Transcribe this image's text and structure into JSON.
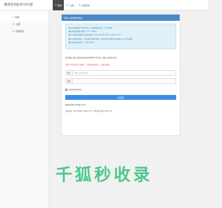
{
  "app": {
    "brand": "聚网签到助手VIP2版"
  },
  "topnav": [
    {
      "icon": "home-icon",
      "label": "登录",
      "active": true
    },
    {
      "icon": "user-icon",
      "label": "注册",
      "active": false
    },
    {
      "icon": "search-icon",
      "label": "找回密码",
      "active": false
    }
  ],
  "sidebar": [
    {
      "icon": "home-icon",
      "label": "登录",
      "active": true
    },
    {
      "icon": "user-icon",
      "label": "注册",
      "active": false
    },
    {
      "icon": "search-icon",
      "label": "找回密码",
      "active": false
    }
  ],
  "panel": {
    "title": "请输入您的账号信息",
    "alert_lines": [
      "●vip功能请购买VIP后使用，可开通/续费年度一个月使用权",
      "●如需帮助请联系客服，QQ：10000",
      "●vip到期后可重新购买继续使用：https://sqbot.10077.qqbao.com/",
      "●vip功能暂停购买，如有疑问请联系客服，联系前请先查看常见问题和公告，联系客服",
      "●如有疑问请加QQ：2060234627"
    ],
    "tip": "您需要输入账户和密码才能使用签到助手VIP2版，请输入您的账号信息",
    "warn": "如账户不存在请先注册账户（不填则自动识别），或联系客服：",
    "fields": [
      {
        "label": "账户",
        "placeholder": "请输入您的登录账户"
      },
      {
        "label": "密码",
        "placeholder": ""
      }
    ],
    "remember_label": "记住我的登录状态",
    "submit_label": "立即登录",
    "version": "聚网签到助手VIP2版 V6.52",
    "env": "当前环境：执行 MySQL 查询 15 次，PHP 运行耗时 2.65 S 秒"
  },
  "watermark": "千狐秒收录",
  "colors": {
    "panel_header": "#4a88c8",
    "alert_bg": "#e1f1f9",
    "alert_text": "#3a89ae",
    "warn": "#d9534f",
    "submit": "#3a8ee6",
    "watermark": "#4ec78e"
  }
}
